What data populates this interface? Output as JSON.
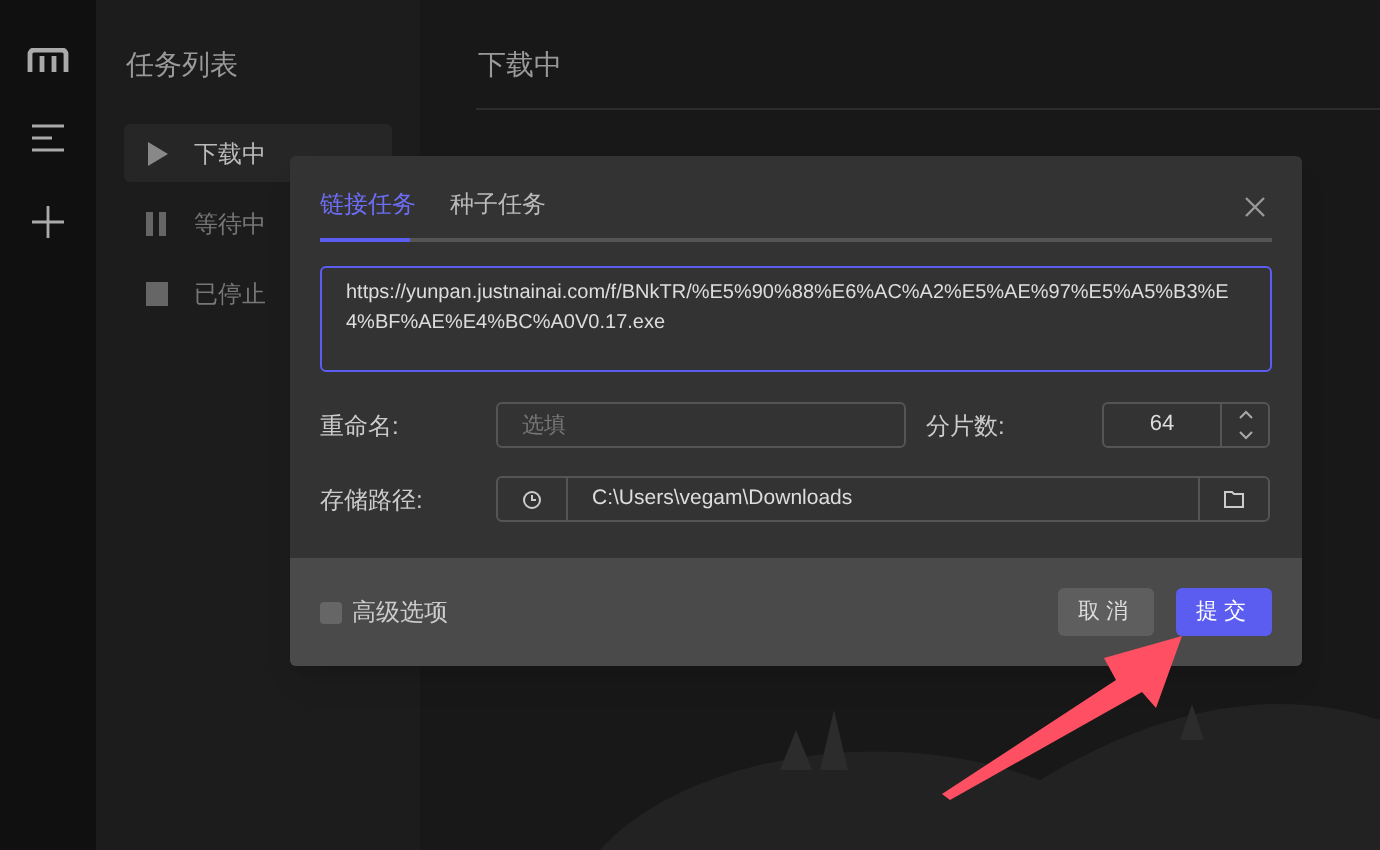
{
  "task_panel": {
    "title": "任务列表",
    "items": [
      {
        "label": "下载中",
        "kind": "play",
        "selected": true
      },
      {
        "label": "等待中",
        "kind": "pause",
        "selected": false
      },
      {
        "label": "已停止",
        "kind": "stop",
        "selected": false
      }
    ]
  },
  "main": {
    "title": "下载中"
  },
  "dialog": {
    "tabs": [
      {
        "label": "链接任务",
        "selected": true
      },
      {
        "label": "种子任务",
        "selected": false
      }
    ],
    "url": "https://yunpan.justnainai.com/f/BNkTR/%E5%90%88%E6%AC%A2%E5%AE%97%E5%A5%B3%E4%BF%AE%E4%BC%A0V0.17.exe",
    "rename": {
      "label": "重命名:",
      "placeholder": "选填"
    },
    "segments": {
      "label": "分片数:",
      "value": "64"
    },
    "save_path": {
      "label": "存储路径:",
      "value": "C:\\Users\\vegam\\Downloads"
    },
    "advanced": {
      "label": "高级选项",
      "checked": false
    },
    "buttons": [
      {
        "label": "取消",
        "kind": "secondary"
      },
      {
        "label": "提交",
        "kind": "primary"
      }
    ]
  }
}
